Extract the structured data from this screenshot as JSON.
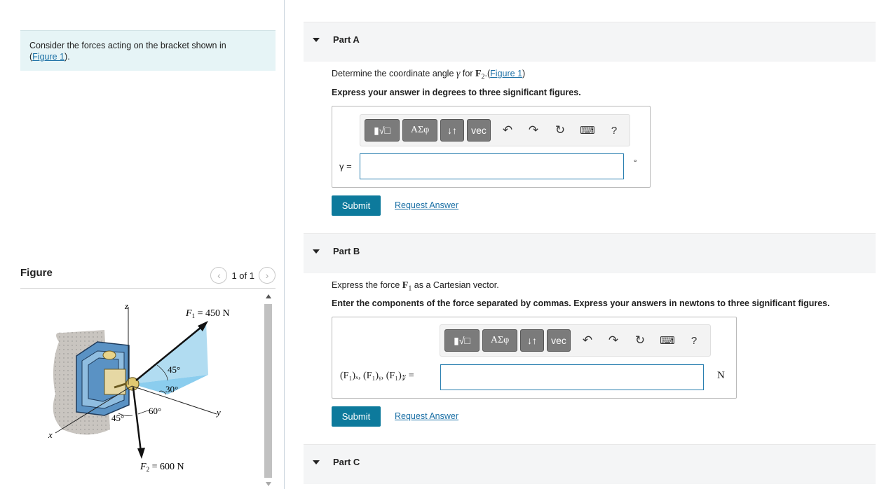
{
  "context": {
    "text": "Consider the forces acting on the bracket shown in",
    "link_open": "(",
    "link": "Figure 1",
    "link_close": ")."
  },
  "figure": {
    "title": "Figure",
    "pager": "1 of 1",
    "labels": {
      "z": "z",
      "y": "y",
      "x": "x",
      "f1_text": "F",
      "f1_sub": "1",
      "f1_value": " = 450 N",
      "f2_text": "F",
      "f2_sub": "2",
      "f2_value": " = 600 N",
      "angle_45_top": "45°",
      "angle_30": "30°",
      "angle_60": "60°",
      "angle_45_bottom": "45°"
    }
  },
  "partA": {
    "title": "Part A",
    "question_pre": "Determine the coordinate angle ",
    "question_gamma": "γ",
    "question_mid": " for ",
    "question_force": "F",
    "question_sub": "2",
    "question_link_open": ".(",
    "question_link": "Figure 1",
    "question_link_close": ")",
    "instruction": "Express your answer in degrees to three significant figures.",
    "label": "γ =",
    "unit": "°",
    "value": "",
    "submit": "Submit",
    "request": "Request Answer"
  },
  "partB": {
    "title": "Part B",
    "question_pre": "Express the force ",
    "question_force": "F",
    "question_sub": "1",
    "question_post": " as a Cartesian vector.",
    "instruction": "Enter the components of the force separated by commas. Express your answers in newtons to three significant figures.",
    "label": "(F₁)ₓ, (F₁)ᵧ, (F₁)𝓏 =",
    "unit": "N",
    "value": "",
    "submit": "Submit",
    "request": "Request Answer"
  },
  "partC": {
    "title": "Part C"
  },
  "toolbar": {
    "templates": "▮√□",
    "greek": "ΑΣφ",
    "arrows": "↓↑",
    "vec": "vec",
    "undo": "↶",
    "redo": "↷",
    "reset": "↻",
    "keyboard": "⌨",
    "help": "?"
  },
  "colors": {
    "submit": "#0d7a9c",
    "link": "#1a6fa5",
    "context_bg": "#e6f4f6",
    "input_border": "#2a7fb0"
  }
}
